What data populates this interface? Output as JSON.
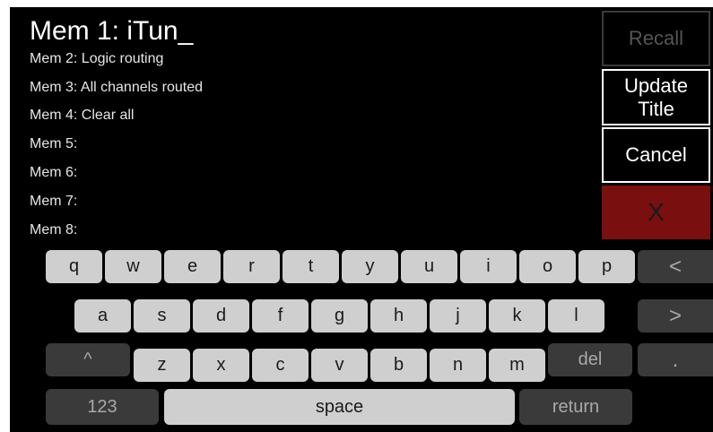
{
  "header": {
    "title": "Mem 1: iTun_"
  },
  "memories": [
    "Mem 2: Logic routing",
    "Mem 3: All channels routed",
    "Mem 4: Clear all",
    "Mem 5:",
    "Mem 6:",
    "Mem 7:",
    "Mem 8:"
  ],
  "side_buttons": {
    "recall": "Recall",
    "update_title": "Update\nTitle",
    "cancel": "Cancel",
    "close": "X"
  },
  "keyboard": {
    "row1": [
      "q",
      "w",
      "e",
      "r",
      "t",
      "y",
      "u",
      "i",
      "o",
      "p"
    ],
    "row1_extra": "<",
    "row2": [
      "a",
      "s",
      "d",
      "f",
      "g",
      "h",
      "j",
      "k",
      "l"
    ],
    "row2_extra": ">",
    "row3_shift": "^",
    "row3": [
      "z",
      "x",
      "c",
      "v",
      "b",
      "n",
      "m"
    ],
    "row3_del": "del",
    "row3_extra": ".",
    "row4_numbers": "123",
    "row4_space": "space",
    "row4_return": "return"
  },
  "colors": {
    "screen_bg": "#000000",
    "key_light": "#cfcfcf",
    "key_dark": "#3a3a3a",
    "close_button": "#7a0f0f"
  }
}
